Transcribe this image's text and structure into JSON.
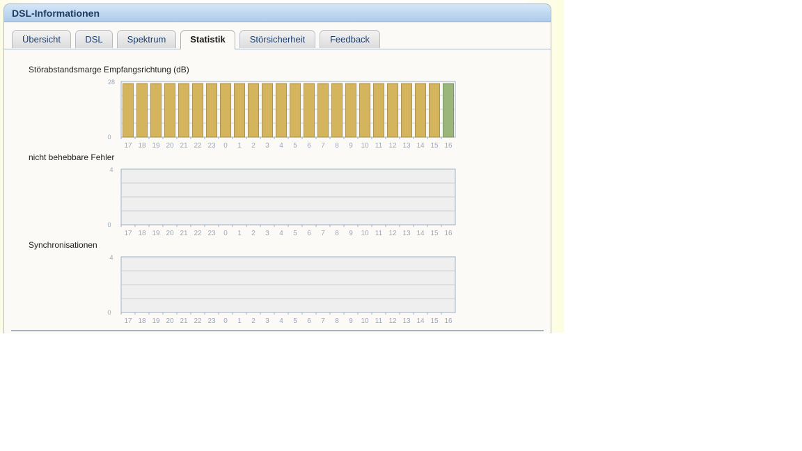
{
  "panel": {
    "title": "DSL-Informationen"
  },
  "tabs": [
    {
      "label": "Übersicht"
    },
    {
      "label": "DSL"
    },
    {
      "label": "Spektrum"
    },
    {
      "label": "Statistik",
      "active": true
    },
    {
      "label": "Störsicherheit"
    },
    {
      "label": "Feedback"
    }
  ],
  "colors": {
    "bar_gold": "#d4b45c",
    "bar_current": "#9cb57a",
    "chart_bg": "#efefef",
    "axis_text": "#98a8bc"
  },
  "chart_data": [
    {
      "type": "bar",
      "title": "Störabstandsmarge Empfangsrichtung (dB)",
      "categories": [
        "17",
        "18",
        "19",
        "20",
        "21",
        "22",
        "23",
        "0",
        "1",
        "2",
        "3",
        "4",
        "5",
        "6",
        "7",
        "8",
        "9",
        "10",
        "11",
        "12",
        "13",
        "14",
        "15",
        "16"
      ],
      "values": [
        28,
        28,
        28,
        28,
        28,
        28,
        28,
        28,
        28,
        28,
        28,
        28,
        28,
        28,
        28,
        28,
        28,
        28,
        28,
        28,
        28,
        28,
        28,
        28
      ],
      "ylim": [
        0,
        28
      ],
      "yticks": [
        "28",
        "0"
      ],
      "highlight_last": true
    },
    {
      "type": "bar",
      "title": "nicht behebbare Fehler",
      "categories": [
        "17",
        "18",
        "19",
        "20",
        "21",
        "22",
        "23",
        "0",
        "1",
        "2",
        "3",
        "4",
        "5",
        "6",
        "7",
        "8",
        "9",
        "10",
        "11",
        "12",
        "13",
        "14",
        "15",
        "16"
      ],
      "values": [
        0,
        0,
        0,
        0,
        0,
        0,
        0,
        0,
        0,
        0,
        0,
        0,
        0,
        0,
        0,
        0,
        0,
        0,
        0,
        0,
        0,
        0,
        0,
        0
      ],
      "ylim": [
        0,
        4
      ],
      "yticks": [
        "4",
        "0"
      ]
    },
    {
      "type": "bar",
      "title": "Synchronisationen",
      "categories": [
        "17",
        "18",
        "19",
        "20",
        "21",
        "22",
        "23",
        "0",
        "1",
        "2",
        "3",
        "4",
        "5",
        "6",
        "7",
        "8",
        "9",
        "10",
        "11",
        "12",
        "13",
        "14",
        "15",
        "16"
      ],
      "values": [
        0,
        0,
        0,
        0,
        0,
        0,
        0,
        0,
        0,
        0,
        0,
        0,
        0,
        0,
        0,
        0,
        0,
        0,
        0,
        0,
        0,
        0,
        0,
        0
      ],
      "ylim": [
        0,
        4
      ],
      "yticks": [
        "4",
        "0"
      ]
    }
  ]
}
